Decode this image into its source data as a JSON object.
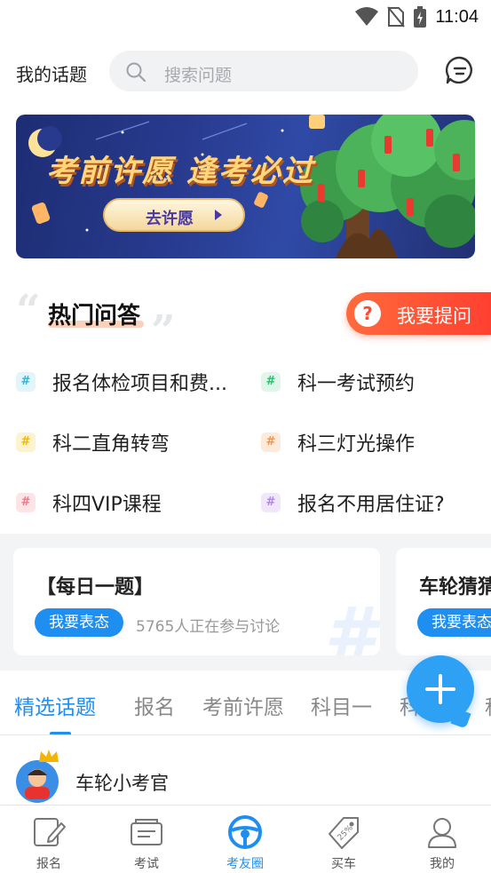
{
  "status_bar": {
    "time": "11:04"
  },
  "header": {
    "title": "我的话题",
    "search_placeholder": "搜索问题"
  },
  "banner": {
    "title": "考前许愿 逢考必过",
    "button_label": "去许愿"
  },
  "hot_qa": {
    "title": "热门问答",
    "ask_button": "我要提问",
    "topics": [
      {
        "label": "报名体检项目和费...",
        "color": "#2fb8d8",
        "bg": "#e1f5fa"
      },
      {
        "label": "科一考试预约",
        "color": "#27c06a",
        "bg": "#e0f6ea"
      },
      {
        "label": "科二直角转弯",
        "color": "#f2b705",
        "bg": "#fdf3cf"
      },
      {
        "label": "科三灯光操作",
        "color": "#f2944a",
        "bg": "#fdeadb"
      },
      {
        "label": "科四VIP课程",
        "color": "#f07a86",
        "bg": "#fde4e7"
      },
      {
        "label": "报名不用居住证?",
        "color": "#b383e8",
        "bg": "#f1e7fc"
      }
    ]
  },
  "cards": [
    {
      "title": "【每日一题】",
      "button": "我要表态",
      "meta": "5765人正在参与讨论"
    },
    {
      "title": "车轮猜猜",
      "button": "我要表态"
    }
  ],
  "tabs": [
    "精选话题",
    "报名",
    "考前许愿",
    "科目一",
    "科目二",
    "科"
  ],
  "post": {
    "author": "车轮小考官"
  },
  "bottom_nav": [
    "报名",
    "考试",
    "考友圈",
    "买车",
    "我的"
  ],
  "colors": {
    "accent": "#1e8ff0",
    "ask_button": "#ff4a32"
  }
}
